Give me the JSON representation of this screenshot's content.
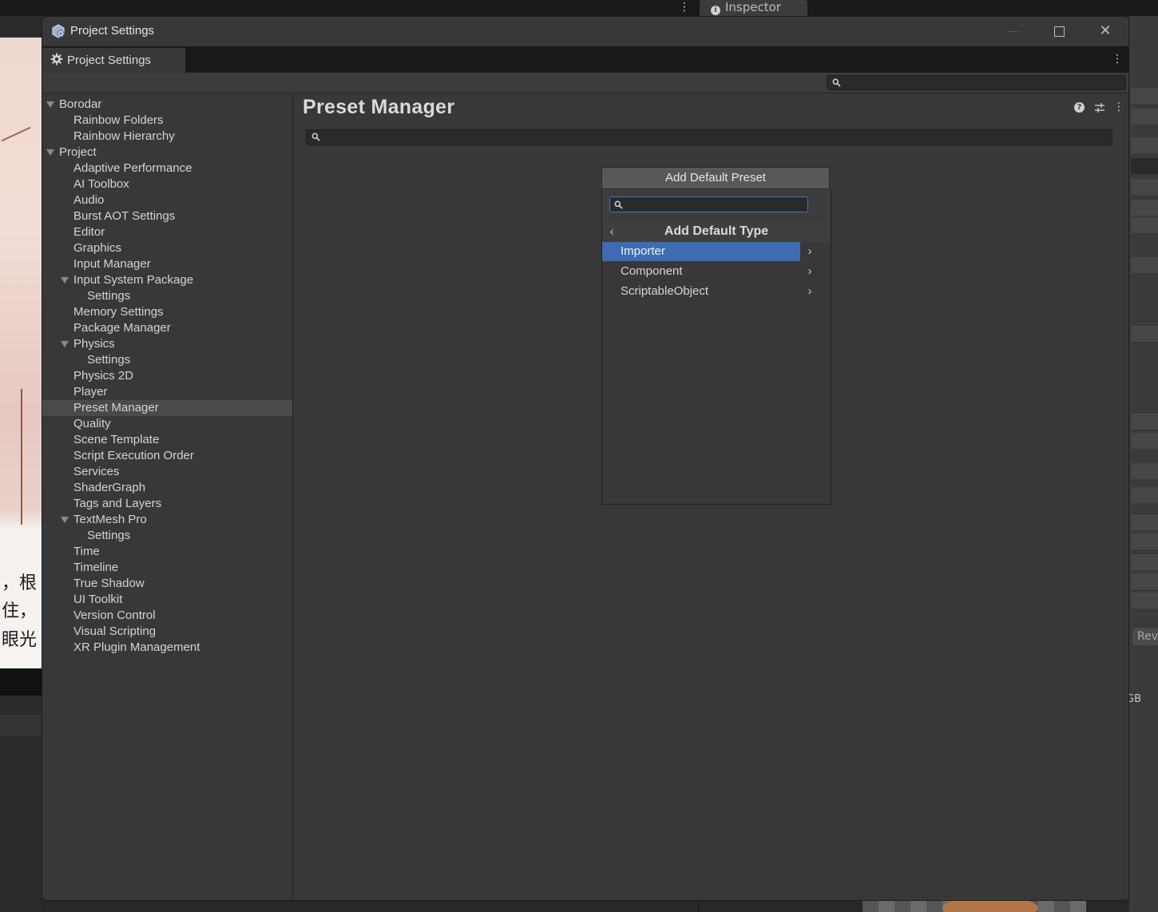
{
  "background": {
    "inspector_tab": "Inspector",
    "cjk_lines": [
      "，根",
      "住，",
      "眼光"
    ],
    "rev_button": "Rev",
    "rgb_label": "GB"
  },
  "window": {
    "title": "Project Settings",
    "tab_label": "Project Settings",
    "controls": {
      "minimize": "—",
      "maximize": "",
      "close": "✕"
    }
  },
  "sidebar": {
    "items": [
      {
        "label": "Borodar",
        "level": 0,
        "expandable": true
      },
      {
        "label": "Rainbow Folders",
        "level": 1
      },
      {
        "label": "Rainbow Hierarchy",
        "level": 1
      },
      {
        "label": "Project",
        "level": 0,
        "expandable": true
      },
      {
        "label": "Adaptive Performance",
        "level": 1
      },
      {
        "label": "AI Toolbox",
        "level": 1
      },
      {
        "label": "Audio",
        "level": 1
      },
      {
        "label": "Burst AOT Settings",
        "level": 1
      },
      {
        "label": "Editor",
        "level": 1
      },
      {
        "label": "Graphics",
        "level": 1
      },
      {
        "label": "Input Manager",
        "level": 1
      },
      {
        "label": "Input System Package",
        "level": 1,
        "expandable": true
      },
      {
        "label": "Settings",
        "level": 2
      },
      {
        "label": "Memory Settings",
        "level": 1
      },
      {
        "label": "Package Manager",
        "level": 1
      },
      {
        "label": "Physics",
        "level": 1,
        "expandable": true
      },
      {
        "label": "Settings",
        "level": 2
      },
      {
        "label": "Physics 2D",
        "level": 1
      },
      {
        "label": "Player",
        "level": 1
      },
      {
        "label": "Preset Manager",
        "level": 1,
        "selected": true
      },
      {
        "label": "Quality",
        "level": 1
      },
      {
        "label": "Scene Template",
        "level": 1
      },
      {
        "label": "Script Execution Order",
        "level": 1
      },
      {
        "label": "Services",
        "level": 1
      },
      {
        "label": "ShaderGraph",
        "level": 1
      },
      {
        "label": "Tags and Layers",
        "level": 1
      },
      {
        "label": "TextMesh Pro",
        "level": 1,
        "expandable": true
      },
      {
        "label": "Settings",
        "level": 2
      },
      {
        "label": "Time",
        "level": 1
      },
      {
        "label": "Timeline",
        "level": 1
      },
      {
        "label": "True Shadow",
        "level": 1
      },
      {
        "label": "UI Toolkit",
        "level": 1
      },
      {
        "label": "Version Control",
        "level": 1
      },
      {
        "label": "Visual Scripting",
        "level": 1
      },
      {
        "label": "XR Plugin Management",
        "level": 1
      }
    ]
  },
  "main": {
    "title": "Preset Manager",
    "search_value": "",
    "add_button": "Add Default Preset"
  },
  "dropdown": {
    "search_value": "",
    "header": "Add Default Type",
    "back_glyph": "‹",
    "items": [
      {
        "label": "Importer",
        "selected": true
      },
      {
        "label": "Component"
      },
      {
        "label": "ScriptableObject"
      }
    ],
    "chevron_glyph": "›"
  },
  "colors": {
    "selection_blue": "#3d6cb3",
    "search_focus": "#3c79c9",
    "panel": "#383838",
    "tabbar": "#191919"
  }
}
